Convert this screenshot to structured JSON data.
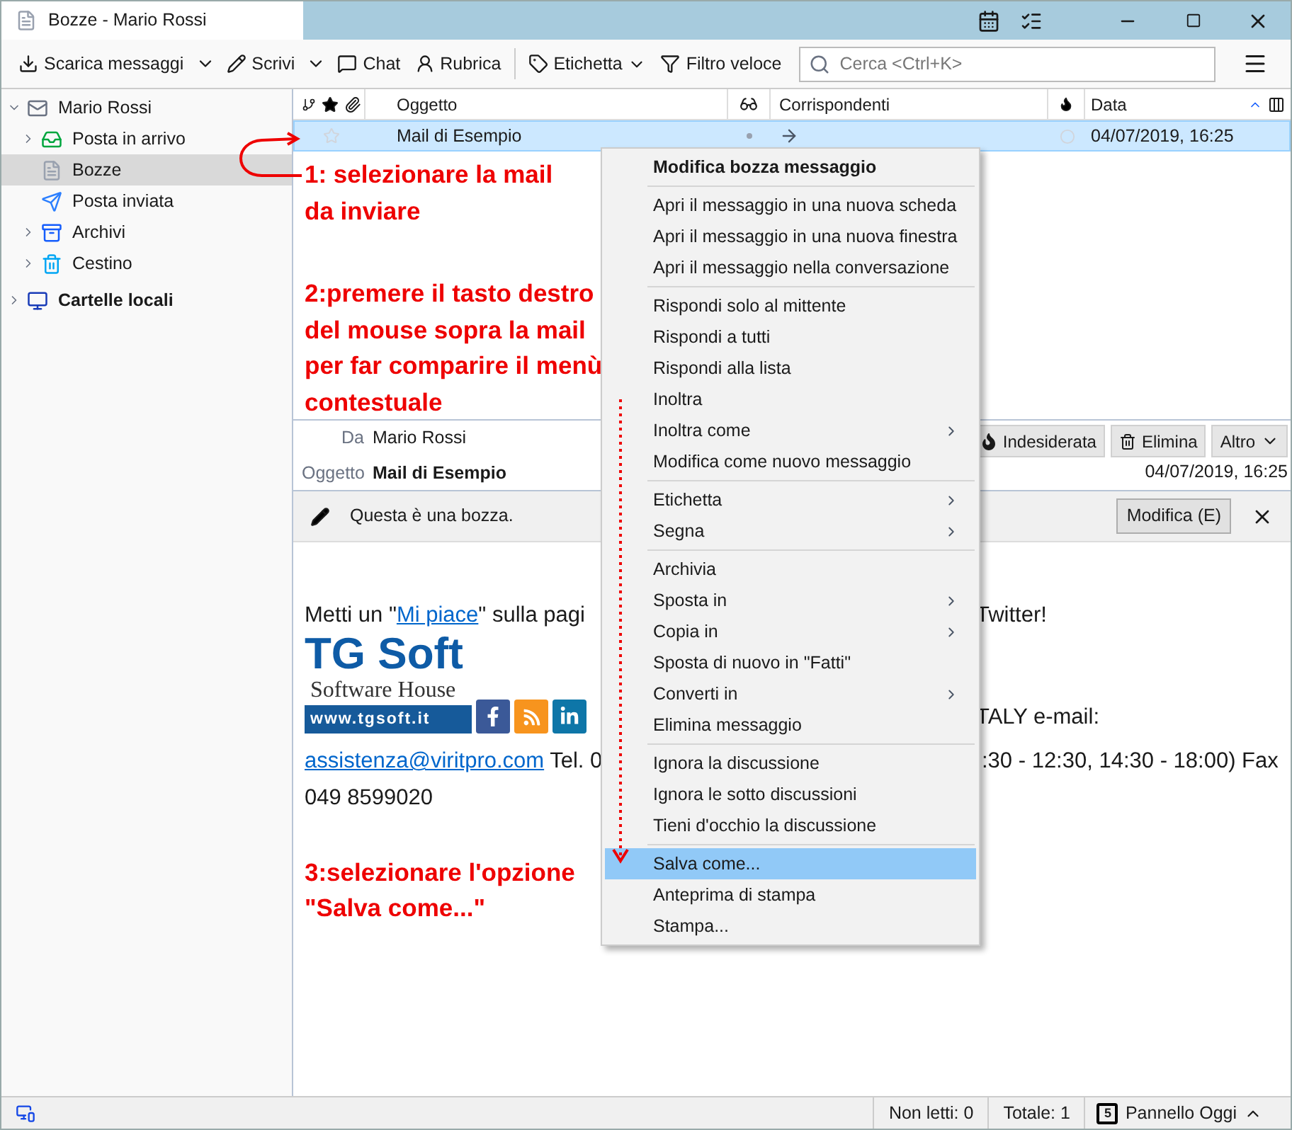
{
  "window": {
    "title": "Bozze - Mario Rossi"
  },
  "toolbar": {
    "buttons": [
      {
        "label": "Scarica messaggi",
        "kind": "split"
      },
      {
        "label": "Scrivi",
        "kind": "split"
      },
      {
        "label": "Chat",
        "kind": "plain"
      },
      {
        "label": "Rubrica",
        "kind": "plain"
      },
      {
        "label": "Etichetta",
        "kind": "menu"
      },
      {
        "label": "Filtro veloce",
        "kind": "plain"
      }
    ],
    "search": {
      "placeholder": "Cerca <Ctrl+K>"
    }
  },
  "folders": [
    {
      "name": "Mario Rossi",
      "kind": "account",
      "expanded": true,
      "selected": false,
      "children": [
        {
          "name": "Posta in arrivo",
          "kind": "inbox",
          "expanded": false,
          "selected": false
        },
        {
          "name": "Bozze",
          "kind": "drafts",
          "selected": true
        },
        {
          "name": "Posta inviata",
          "kind": "sent",
          "selected": false
        },
        {
          "name": "Archivi",
          "kind": "archive",
          "expanded": false,
          "selected": false
        },
        {
          "name": "Cestino",
          "kind": "trash",
          "expanded": false,
          "selected": false
        }
      ]
    },
    {
      "name": "Cartelle locali",
      "kind": "local",
      "expanded": false,
      "selected": false
    }
  ],
  "thread_list": {
    "columns": [
      {
        "label": "Oggetto",
        "kind": "subject"
      },
      {
        "label": "Corrispondenti",
        "kind": "correspondents"
      },
      {
        "label": "Data",
        "kind": "date",
        "sort_ascending": true
      }
    ],
    "rows": [
      {
        "subject": "Mail di Esempio",
        "date": "04/07/2019, 16:25",
        "starred": false,
        "selected": true
      }
    ]
  },
  "annotations": [
    {
      "text": "1: selezionare la mail da inviare"
    },
    {
      "text": "2:premere il tasto destro del mouse sopra la mail per far comparire il menù contestuale"
    },
    {
      "text": "3:selezionare l'opzione \"Salva come...\""
    }
  ],
  "message_header": {
    "from_label": "Da",
    "from": "Mario Rossi",
    "subject_label": "Oggetto",
    "subject": "Mail di Esempio",
    "date": "04/07/2019, 16:25",
    "buttons": [
      {
        "label": "Indesiderata",
        "kind": "junk"
      },
      {
        "label": "Elimina",
        "kind": "delete"
      },
      {
        "label": "Altro",
        "kind": "more"
      }
    ]
  },
  "notification": {
    "text": "Questa è una bozza.",
    "button": "Modifica (E)"
  },
  "body": {
    "likes": {
      "before": "Metti un \"",
      "link": "Mi piace",
      "after": "\" sulla pagi",
      "right": "Twitter!"
    },
    "logo": {
      "title": "TG Soft",
      "subtitle": "Software House",
      "url": "www.tgsoft.it"
    },
    "contact_right": "TALY e-mail:",
    "contact": {
      "email": "assistenza@viritpro.com",
      "after": " Tel. 0",
      "right": ":30 - 12:30, 14:30 - 18:00) Fax"
    },
    "fax": "049 8599020"
  },
  "context_menu": [
    {
      "label": "Modifica bozza messaggio",
      "kind": "header",
      "selected": false
    },
    {
      "kind": "separator"
    },
    {
      "label": "Apri il messaggio in una nuova scheda",
      "kind": "item",
      "selected": false
    },
    {
      "label": "Apri il messaggio in una nuova finestra",
      "kind": "item",
      "selected": false
    },
    {
      "label": "Apri il messaggio nella conversazione",
      "kind": "item",
      "selected": false
    },
    {
      "kind": "separator"
    },
    {
      "label": "Rispondi solo al mittente",
      "kind": "item",
      "selected": false
    },
    {
      "label": "Rispondi a tutti",
      "kind": "item",
      "selected": false
    },
    {
      "label": "Rispondi alla lista",
      "kind": "item",
      "selected": false
    },
    {
      "label": "Inoltra",
      "kind": "item",
      "selected": false
    },
    {
      "label": "Inoltra come",
      "kind": "submenu",
      "selected": false
    },
    {
      "label": "Modifica come nuovo messaggio",
      "kind": "item",
      "selected": false
    },
    {
      "kind": "separator"
    },
    {
      "label": "Etichetta",
      "kind": "submenu",
      "selected": false
    },
    {
      "label": "Segna",
      "kind": "submenu",
      "selected": false
    },
    {
      "kind": "separator"
    },
    {
      "label": "Archivia",
      "kind": "item",
      "selected": false
    },
    {
      "label": "Sposta in",
      "kind": "submenu",
      "selected": false
    },
    {
      "label": "Copia in",
      "kind": "submenu",
      "selected": false
    },
    {
      "label": "Sposta di nuovo in \"Fatti\"",
      "kind": "item",
      "selected": false
    },
    {
      "label": "Converti in",
      "kind": "submenu",
      "selected": false
    },
    {
      "label": "Elimina messaggio",
      "kind": "item",
      "selected": false
    },
    {
      "kind": "separator"
    },
    {
      "label": "Ignora la discussione",
      "kind": "item",
      "selected": false
    },
    {
      "label": "Ignora le sotto discussioni",
      "kind": "item",
      "selected": false
    },
    {
      "label": "Tieni d'occhio la discussione",
      "kind": "item",
      "selected": false
    },
    {
      "kind": "separator"
    },
    {
      "label": "Salva come...",
      "kind": "item",
      "selected": true
    },
    {
      "label": "Anteprima di stampa",
      "kind": "item",
      "selected": false
    },
    {
      "label": "Stampa...",
      "kind": "item",
      "selected": false
    }
  ],
  "status_bar": {
    "unread": "Non letti: 0",
    "total": "Totale: 1",
    "today_day": "5",
    "today_pane": "Pannello Oggi",
    "today_expanded": false
  }
}
